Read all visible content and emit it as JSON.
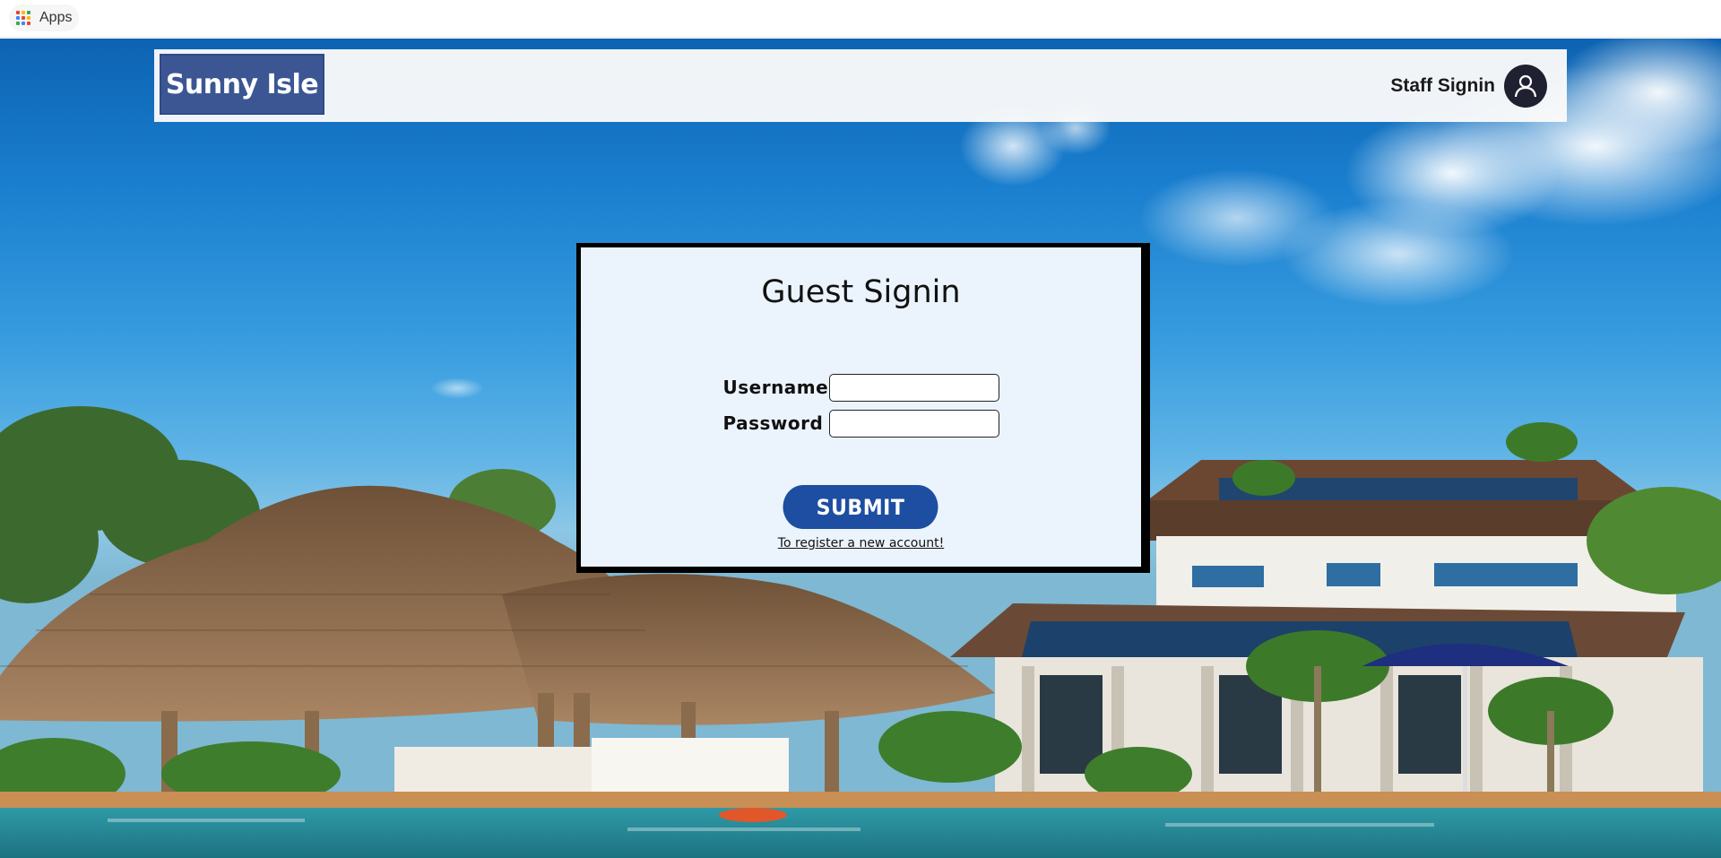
{
  "browser": {
    "bookmarks": {
      "apps_label": "Apps"
    },
    "apps_icon_colors": [
      "#ea4335",
      "#fbbc05",
      "#34a853",
      "#4285f4",
      "#ea4335",
      "#fbbc05",
      "#34a853",
      "#4285f4",
      "#ea4335"
    ]
  },
  "header": {
    "brand": "Sunny Isle",
    "staff_signin_label": "Staff Signin",
    "avatar_icon": "user-avatar-icon"
  },
  "signin": {
    "title": "Guest Signin",
    "username_label": "Username",
    "username_value": "",
    "password_label": "Password",
    "password_value": "",
    "submit_label": "SUBMIT",
    "register_link": "To register a new account!"
  },
  "colors": {
    "brand_bg": "#3b5693",
    "submit_bg": "#1d4ea1",
    "card_bg": "#ebf4fc",
    "card_border": "#000000",
    "avatar_bg": "#1f2130"
  }
}
